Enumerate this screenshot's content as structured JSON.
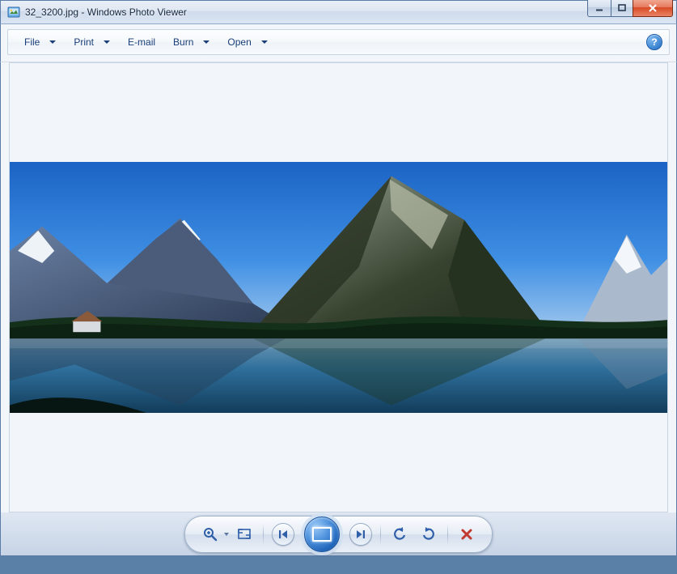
{
  "window": {
    "filename": "32_3200.jpg",
    "separator": " - ",
    "app_name": "Windows Photo Viewer"
  },
  "titlebar_controls": {
    "minimize": "minimize",
    "maximize": "maximize",
    "close": "close"
  },
  "menu": {
    "file": "File",
    "print": "Print",
    "email": "E-mail",
    "burn": "Burn",
    "open": "Open",
    "help_tooltip": "Help"
  },
  "image": {
    "alt": "Panoramic landscape photograph of mountains and a lake under a clear blue sky"
  },
  "controls": {
    "zoom": "Change the display size",
    "fit": "Fit to window",
    "previous": "Previous",
    "slideshow": "Play slide show",
    "next": "Next",
    "rotate_ccw": "Rotate counterclockwise",
    "rotate_cw": "Rotate clockwise",
    "delete": "Delete"
  }
}
